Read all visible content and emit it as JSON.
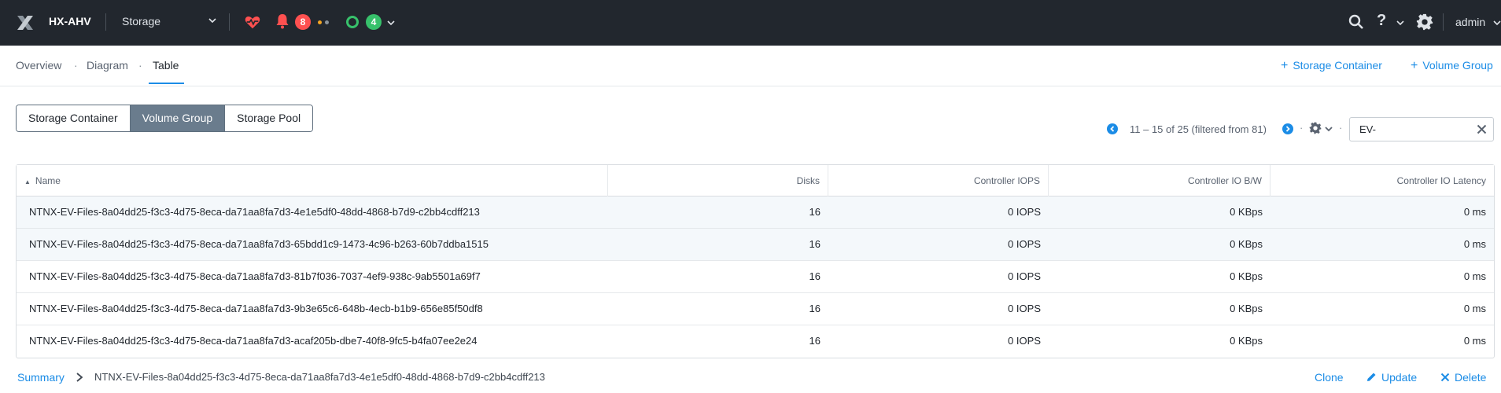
{
  "header": {
    "cluster_name": "HX-AHV",
    "page": "Storage",
    "alerts_count": "8",
    "tasks_count": "4",
    "user": "admin"
  },
  "subnav": {
    "tabs": [
      {
        "label": "Overview"
      },
      {
        "label": "Diagram"
      },
      {
        "label": "Table"
      }
    ],
    "active_tab": "Table",
    "separator": "·",
    "actions": [
      {
        "plus": "+",
        "label": "Storage Container"
      },
      {
        "plus": "+",
        "label": "Volume Group"
      }
    ]
  },
  "segments": {
    "options": [
      "Storage Container",
      "Volume Group",
      "Storage Pool"
    ],
    "selected": "Volume Group"
  },
  "pager": {
    "text": "11 – 15 of 25 (filtered from 81)",
    "dot": "·"
  },
  "filter": {
    "value": "EV-"
  },
  "table": {
    "columns": [
      "Name",
      "Disks",
      "Controller IOPS",
      "Controller IO B/W",
      "Controller IO Latency"
    ],
    "sort_indicator": "▲",
    "rows": [
      {
        "name": "NTNX-EV-Files-8a04dd25-f3c3-4d75-8eca-da71aa8fa7d3-4e1e5df0-48dd-4868-b7d9-c2bb4cdff213",
        "disks": "16",
        "iops": "0 IOPS",
        "bw": "0 KBps",
        "latency": "0 ms"
      },
      {
        "name": "NTNX-EV-Files-8a04dd25-f3c3-4d75-8eca-da71aa8fa7d3-65bdd1c9-1473-4c96-b263-60b7ddba1515",
        "disks": "16",
        "iops": "0 IOPS",
        "bw": "0 KBps",
        "latency": "0 ms"
      },
      {
        "name": "NTNX-EV-Files-8a04dd25-f3c3-4d75-8eca-da71aa8fa7d3-81b7f036-7037-4ef9-938c-9ab5501a69f7",
        "disks": "16",
        "iops": "0 IOPS",
        "bw": "0 KBps",
        "latency": "0 ms"
      },
      {
        "name": "NTNX-EV-Files-8a04dd25-f3c3-4d75-8eca-da71aa8fa7d3-9b3e65c6-648b-4ecb-b1b9-656e85f50df8",
        "disks": "16",
        "iops": "0 IOPS",
        "bw": "0 KBps",
        "latency": "0 ms"
      },
      {
        "name": "NTNX-EV-Files-8a04dd25-f3c3-4d75-8eca-da71aa8fa7d3-acaf205b-dbe7-40f8-9fc5-b4fa07ee2e24",
        "disks": "16",
        "iops": "0 IOPS",
        "bw": "0 KBps",
        "latency": "0 ms"
      }
    ]
  },
  "footer": {
    "summary_label": "Summary",
    "selected_name": "NTNX-EV-Files-8a04dd25-f3c3-4d75-8eca-da71aa8fa7d3-4e1e5df0-48dd-4868-b7d9-c2bb4cdff213",
    "actions": [
      {
        "icon": "",
        "label": "Clone"
      },
      {
        "icon": "pencil-icon",
        "label": "Update"
      },
      {
        "icon": "x-icon",
        "label": "Delete"
      }
    ]
  },
  "colors": {
    "header_bg": "#22272e",
    "accent": "#1b8ce6",
    "alert_red": "#ff5050",
    "ok_green": "#37c16b",
    "segment_selected": "#6a7c8d"
  }
}
